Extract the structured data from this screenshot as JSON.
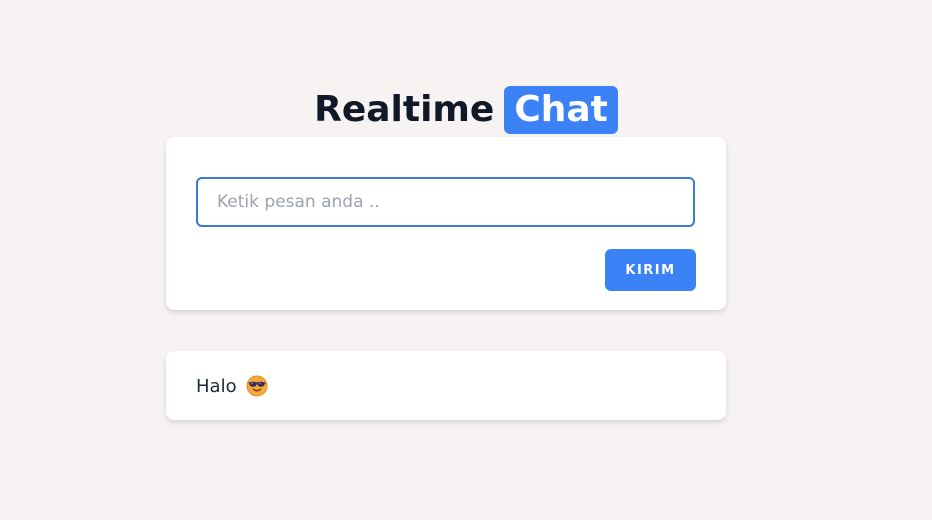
{
  "header": {
    "title_plain": "Realtime",
    "title_highlight": "Chat"
  },
  "composer": {
    "placeholder": "Ketik pesan anda ..",
    "value": "",
    "send_label": "KIRIM"
  },
  "messages": [
    {
      "text": "Halo",
      "emoji": "smiling-face-with-sunglasses-icon"
    }
  ],
  "colors": {
    "background": "#f7f3f3",
    "accent": "#3b82f6",
    "card": "#ffffff",
    "title_text": "#111827"
  }
}
